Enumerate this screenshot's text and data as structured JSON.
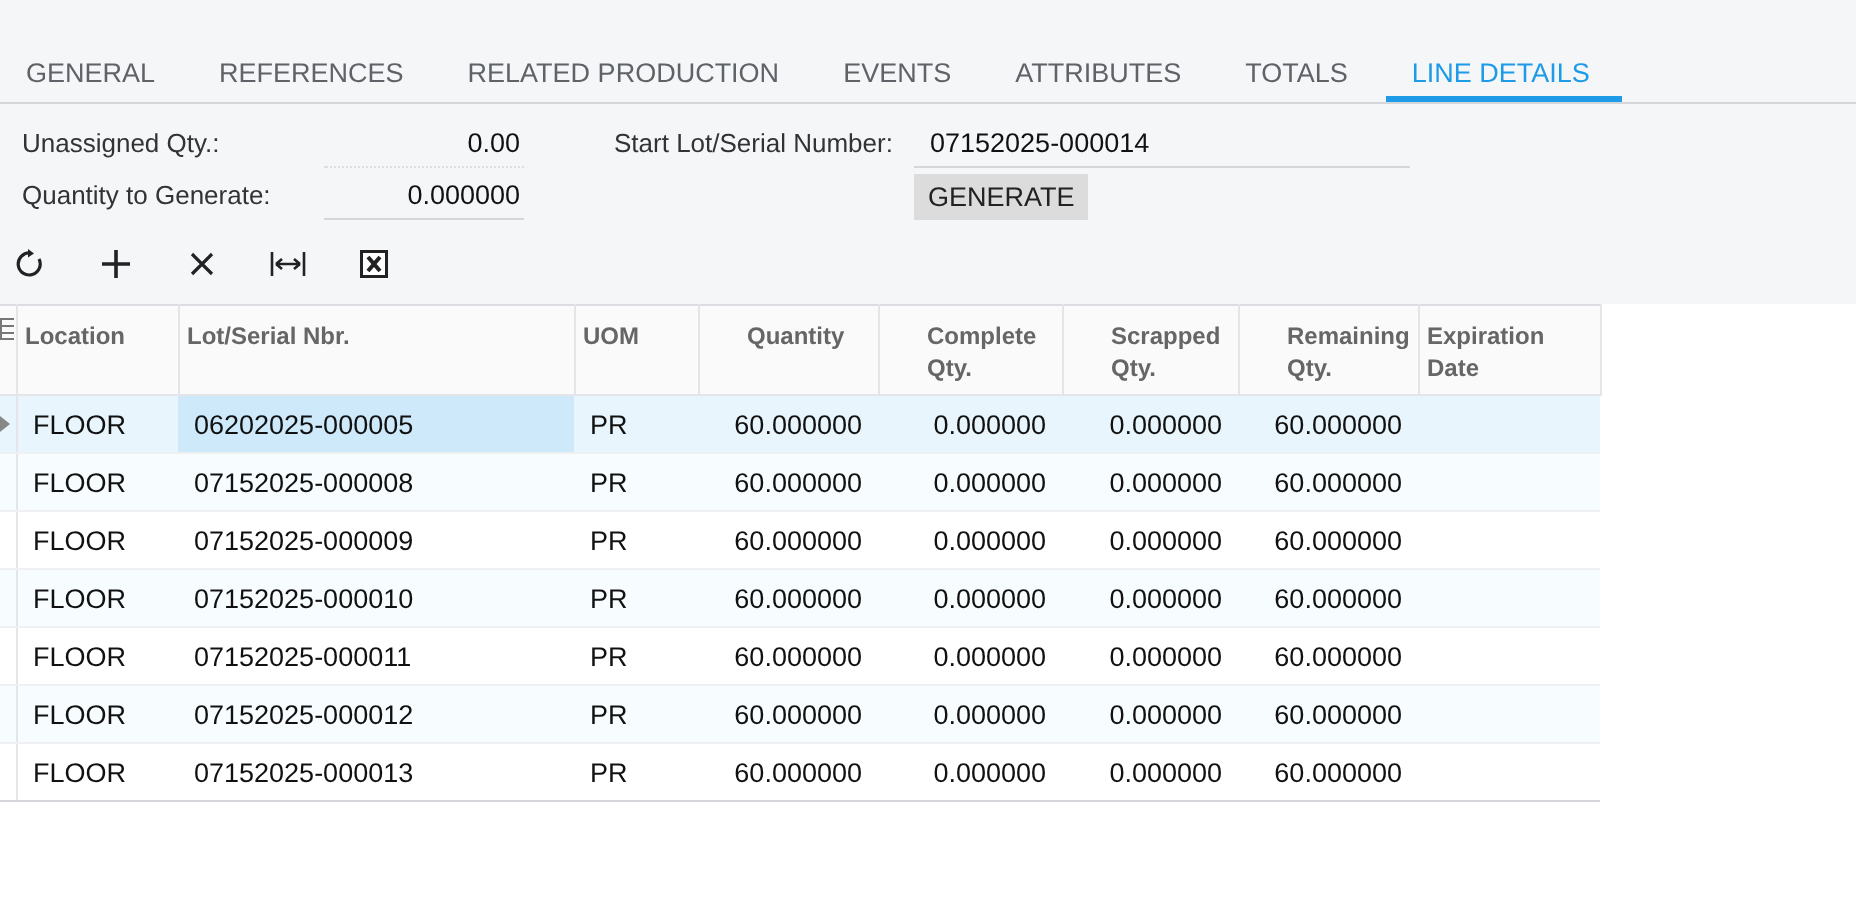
{
  "tabs": [
    {
      "label": "GENERAL",
      "selected": false
    },
    {
      "label": "REFERENCES",
      "selected": false
    },
    {
      "label": "RELATED PRODUCTION",
      "selected": false
    },
    {
      "label": "EVENTS",
      "selected": false
    },
    {
      "label": "ATTRIBUTES",
      "selected": false
    },
    {
      "label": "TOTALS",
      "selected": false
    },
    {
      "label": "LINE DETAILS",
      "selected": true
    }
  ],
  "form": {
    "unassigned_qty": {
      "label": "Unassigned Qty.:",
      "value": "0.00"
    },
    "quantity_to_generate": {
      "label": "Quantity to Generate:",
      "value": "0.000000"
    },
    "start_lot_serial_number": {
      "label": "Start Lot/Serial Number:",
      "value": "07152025-000014"
    },
    "generate_button": "GENERATE"
  },
  "toolbar": [
    {
      "kind": "refresh"
    },
    {
      "kind": "add"
    },
    {
      "kind": "delete"
    },
    {
      "kind": "fit"
    },
    {
      "kind": "excel"
    }
  ],
  "table": {
    "columns": [
      "Location",
      "Lot/Serial Nbr.",
      "UOM",
      "Quantity",
      "Complete Qty.",
      "Scrapped Qty.",
      "Remaining Qty.",
      "Expiration Date"
    ],
    "rows": [
      {
        "selected": true,
        "cells": [
          "FLOOR",
          "06202025-000005",
          "PR",
          "60.000000",
          "0.000000",
          "0.000000",
          "60.000000",
          ""
        ]
      },
      {
        "selected": false,
        "cells": [
          "FLOOR",
          "07152025-000008",
          "PR",
          "60.000000",
          "0.000000",
          "0.000000",
          "60.000000",
          ""
        ]
      },
      {
        "selected": false,
        "cells": [
          "FLOOR",
          "07152025-000009",
          "PR",
          "60.000000",
          "0.000000",
          "0.000000",
          "60.000000",
          ""
        ]
      },
      {
        "selected": false,
        "cells": [
          "FLOOR",
          "07152025-000010",
          "PR",
          "60.000000",
          "0.000000",
          "0.000000",
          "60.000000",
          ""
        ]
      },
      {
        "selected": false,
        "cells": [
          "FLOOR",
          "07152025-000011",
          "PR",
          "60.000000",
          "0.000000",
          "0.000000",
          "60.000000",
          ""
        ]
      },
      {
        "selected": false,
        "cells": [
          "FLOOR",
          "07152025-000012",
          "PR",
          "60.000000",
          "0.000000",
          "0.000000",
          "60.000000",
          ""
        ]
      },
      {
        "selected": false,
        "cells": [
          "FLOOR",
          "07152025-000013",
          "PR",
          "60.000000",
          "0.000000",
          "0.000000",
          "60.000000",
          ""
        ]
      }
    ]
  }
}
